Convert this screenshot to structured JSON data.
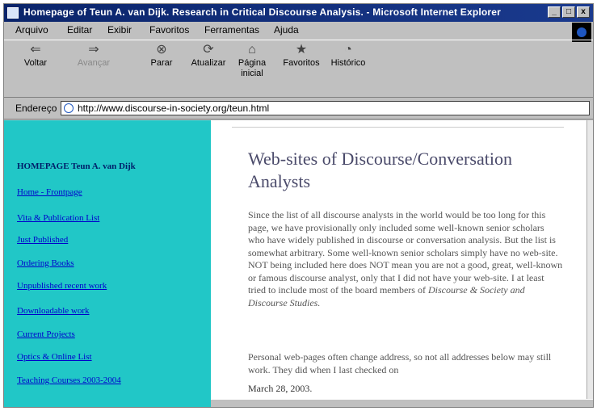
{
  "window": {
    "title": "Homepage of Teun A. van Dijk. Research in Critical Discourse Analysis. - Microsoft Internet Explorer",
    "controls": [
      "_",
      "□",
      "x"
    ]
  },
  "menu": [
    "Arquivo",
    "Editar",
    "Exibir",
    "Favoritos",
    "Ferramentas",
    "Ajuda"
  ],
  "toolbar": {
    "back": "Voltar",
    "forward": "Avançar",
    "stop": "Parar",
    "refresh": "Atualizar",
    "home_line1": "Página",
    "home_line2": "inicial",
    "favorites": "Favoritos",
    "history": "Histórico"
  },
  "address": {
    "label": "Endereço",
    "url": "http://www.discourse-in-society.org/teun.html"
  },
  "sidebar": {
    "title": "HOMEPAGE Teun A. van Dijk",
    "links": [
      "Home - Frontpage",
      "Vita & Publication List",
      "Just Published",
      "Ordering Books",
      "Unpublished recent work",
      "Downloadable work",
      "Current Projects",
      "Optics & Online List",
      "Teaching Courses 2003-2004"
    ]
  },
  "main": {
    "title": "Web-sites of Discourse/Conversation Analysts",
    "para1": "Since the list of all discourse analysts in the world would be too long for this page, we have provisionally only included some well-known senior scholars who have widely published in discourse or conversation analysis. But the list is somewhat arbitrary. Some well-known senior scholars simply have no web-site. NOT being included here does NOT mean you are not a good, great, well-known or famous discourse analyst, only that I did not have your web-site. I at least tried to include most of the board members of",
    "para1_journals": "Discourse & Society and Discourse Studies.",
    "para2": "Personal web-pages often change address, so not all addresses below may still work. They did when I last checked on",
    "date": "March 28, 2003."
  }
}
